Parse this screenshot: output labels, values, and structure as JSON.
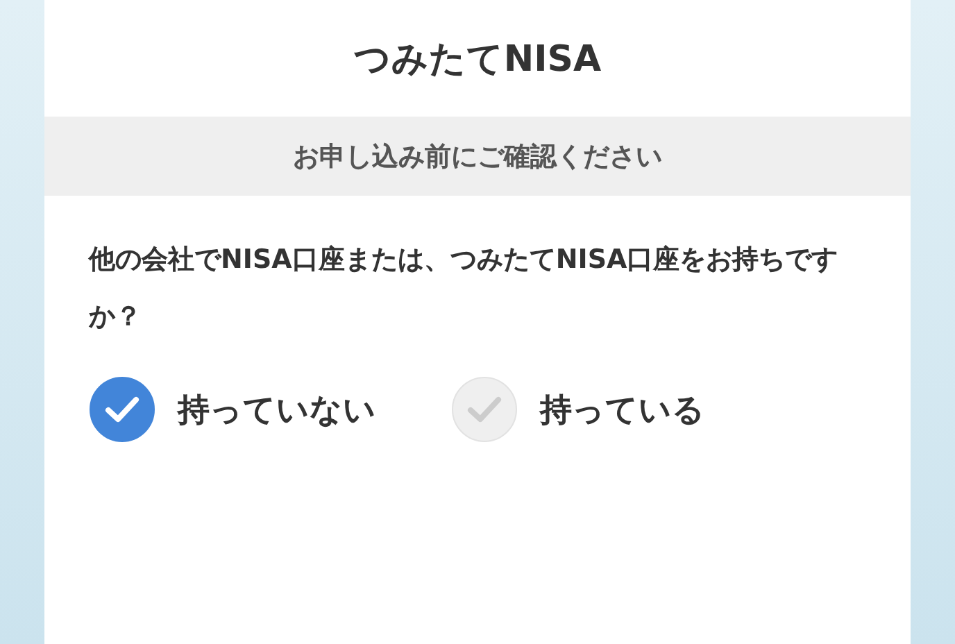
{
  "title": "つみたてNISA",
  "notice": "お申し込み前にご確認ください",
  "question": "他の会社でNISA口座または、つみたてNISA口座をお持ちですか？",
  "options": [
    {
      "label": "持っていない",
      "selected": true
    },
    {
      "label": "持っている",
      "selected": false
    }
  ]
}
